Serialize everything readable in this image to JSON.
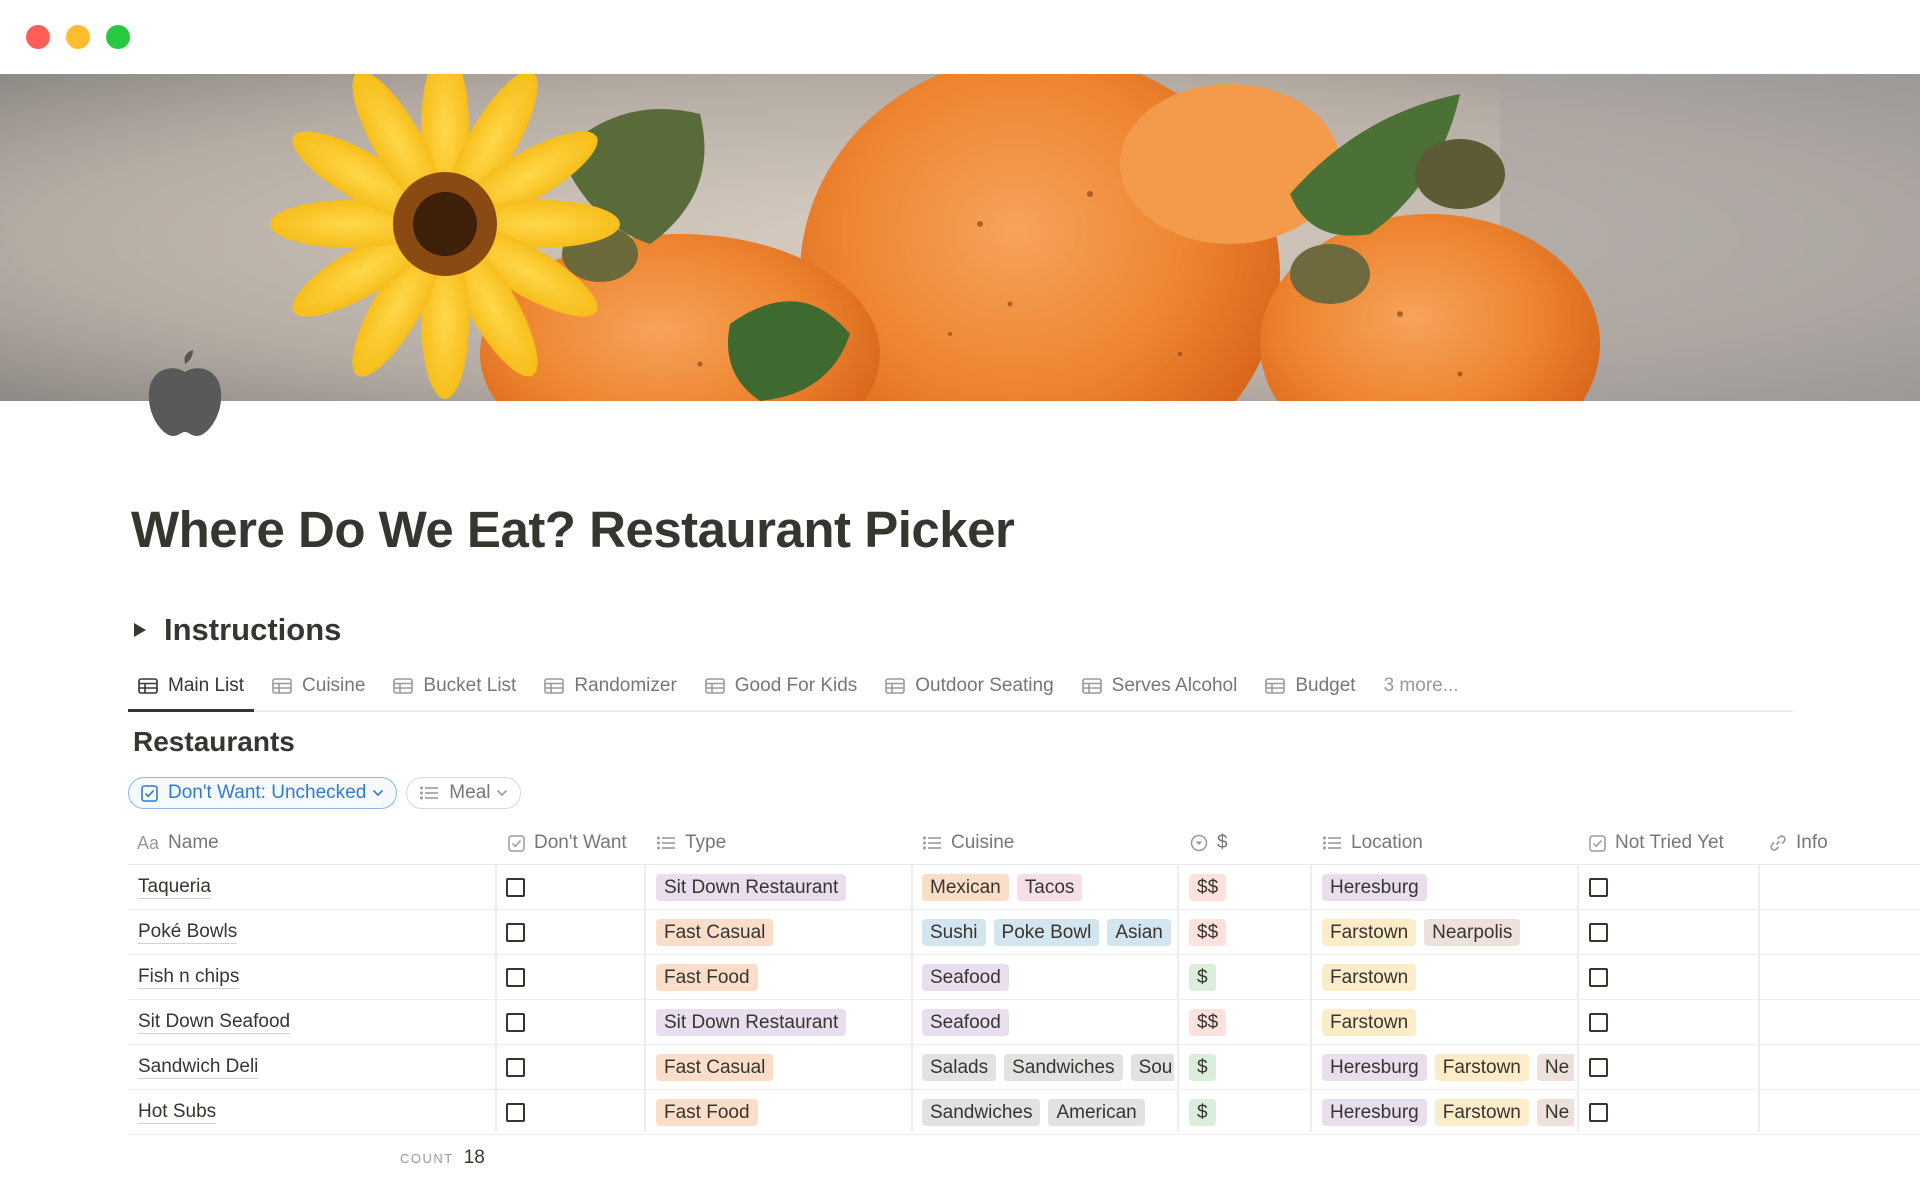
{
  "page": {
    "title": "Where Do We Eat? Restaurant Picker",
    "toggle_label": "Instructions"
  },
  "tabs": [
    {
      "label": "Main List",
      "icon": "table-icon",
      "active": true
    },
    {
      "label": "Cuisine",
      "icon": "table-icon"
    },
    {
      "label": "Bucket List",
      "icon": "table-icon"
    },
    {
      "label": "Randomizer",
      "icon": "table-icon"
    },
    {
      "label": "Good For Kids",
      "icon": "table-icon"
    },
    {
      "label": "Outdoor Seating",
      "icon": "table-icon"
    },
    {
      "label": "Serves Alcohol",
      "icon": "table-icon"
    },
    {
      "label": "Budget",
      "icon": "table-icon"
    }
  ],
  "tabs_more": "3 more...",
  "database": {
    "title": "Restaurants",
    "filters": {
      "dont_want": "Don't Want: Unchecked",
      "meal": "Meal"
    },
    "columns": {
      "name": "Name",
      "name_prefix": "Aa",
      "dont_want": "Don't Want",
      "type": "Type",
      "cuisine": "Cuisine",
      "price": "$",
      "location": "Location",
      "not_tried": "Not Tried Yet",
      "info": "Info"
    },
    "rows": [
      {
        "name": "Taqueria",
        "type": "Sit Down Restaurant",
        "cuisine": [
          "Mexican",
          "Tacos"
        ],
        "price": "$$",
        "location": [
          "Heresburg"
        ]
      },
      {
        "name": "Poké Bowls",
        "type": "Fast Casual",
        "cuisine": [
          "Sushi",
          "Poke Bowl",
          "Asian"
        ],
        "price": "$$",
        "location": [
          "Farstown",
          "Nearpolis"
        ]
      },
      {
        "name": "Fish n chips",
        "type": "Fast Food",
        "cuisine": [
          "Seafood"
        ],
        "price": "$",
        "location": [
          "Farstown"
        ]
      },
      {
        "name": "Sit Down Seafood",
        "type": "Sit Down Restaurant",
        "cuisine": [
          "Seafood"
        ],
        "price": "$$",
        "location": [
          "Farstown"
        ]
      },
      {
        "name": "Sandwich Deli",
        "type": "Fast Casual",
        "cuisine": [
          "Salads",
          "Sandwiches",
          "Sou"
        ],
        "price": "$",
        "location": [
          "Heresburg",
          "Farstown",
          "Ne"
        ]
      },
      {
        "name": "Hot Subs",
        "type": "Fast Food",
        "cuisine": [
          "Sandwiches",
          "American"
        ],
        "price": "$",
        "location": [
          "Heresburg",
          "Farstown",
          "Ne"
        ]
      }
    ],
    "footer": {
      "label": "COUNT",
      "value": "18"
    }
  },
  "colors": {
    "Sit Down Restaurant": "#e8deee",
    "Fast Casual": "#fadec9",
    "Fast Food": "#fadec9",
    "Mexican": "#fadec9",
    "Tacos": "#f5e0e9",
    "Sushi": "#d3e5ef",
    "Poke Bowl": "#d3e5ef",
    "Asian": "#d3e5ef",
    "Seafood": "#e8deee",
    "Salads": "#e3e2e0",
    "Sandwiches": "#e3e2e0",
    "Sou": "#e3e2e0",
    "American": "#e3e2e0",
    "$$": "#ffe2dd",
    "$": "#dbeddb",
    "Heresburg": "#e8deee",
    "Farstown": "#fdecc8",
    "Nearpolis": "#eee0da",
    "Ne": "#eee0da"
  }
}
